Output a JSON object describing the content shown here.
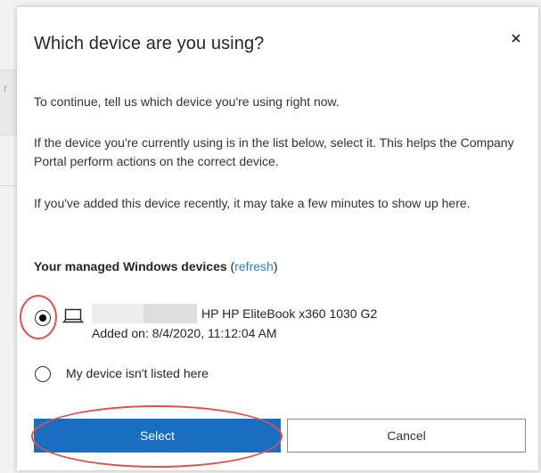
{
  "dialog": {
    "title": "Which device are you using?",
    "close_icon": "close-icon",
    "paragraphs": [
      "To continue, tell us which device you're using right now.",
      "If the device you're currently using is in the list below, select it. This helps the Company Portal perform actions on the correct device.",
      "If you've added this device recently, it may take a few minutes to show up here."
    ],
    "section_heading": "Your managed Windows devices",
    "refresh_open": " (",
    "refresh_label": "refresh",
    "refresh_close": ")",
    "devices": [
      {
        "name": "HP HP EliteBook x360 1030 G2",
        "added": "Added on: 8/4/2020, 11:12:04 AM",
        "icon": "laptop-icon",
        "selected": true
      }
    ],
    "not_listed_label": "My device isn't listed here",
    "select_label": "Select",
    "cancel_label": "Cancel"
  },
  "colors": {
    "primary": "#1a6ec2",
    "link": "#2b7cd3",
    "annotation": "#e0524f"
  },
  "background": {
    "partial_letter": "r"
  }
}
